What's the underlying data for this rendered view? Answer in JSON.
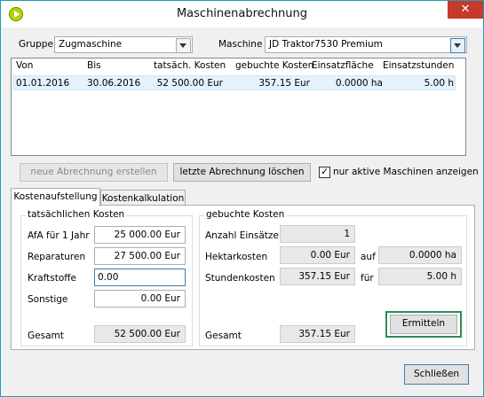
{
  "window": {
    "title": "Maschinenabrechnung",
    "close_glyph": "✕"
  },
  "filter": {
    "gruppe_label": "Gruppe",
    "gruppe_value": "Zugmaschine",
    "maschine_label": "Maschine",
    "maschine_value": "JD Traktor7530 Premium"
  },
  "table": {
    "columns": [
      "Von",
      "Bis",
      "tatsäch. Kosten",
      "gebuchte Kosten",
      "Einsatzfläche",
      "Einsatzstunden"
    ],
    "rows": [
      [
        "01.01.2016",
        "30.06.2016",
        "52 500.00 Eur",
        "357.15 Eur",
        "0.0000 ha",
        "5.00 h"
      ]
    ]
  },
  "actions": {
    "new_label": "neue Abrechnung erstellen",
    "delete_label": "letzte Abrechnung löschen",
    "active_only_label": "nur aktive Maschinen anzeigen",
    "active_only_checked": true
  },
  "tabs": [
    "Kostenaufstellung",
    "Kostenkalkulation"
  ],
  "actual": {
    "title": "tatsächlichen Kosten",
    "afa_label": "AfA für 1 Jahr",
    "afa_value": "25 000.00 Eur",
    "rep_label": "Reparaturen",
    "rep_value": "27 500.00 Eur",
    "kraft_label": "Kraftstoffe",
    "kraft_value": "0.00",
    "sonst_label": "Sonstige",
    "sonst_value": "0.00 Eur",
    "total_label": "Gesamt",
    "total_value": "52 500.00 Eur"
  },
  "booked": {
    "title": "gebuchte Kosten",
    "count_label": "Anzahl Einsätze",
    "count_value": "1",
    "ha_label": "Hektarkosten",
    "ha_value": "0.00 Eur",
    "auf_label": "auf",
    "auf_value": "0.0000 ha",
    "hour_label": "Stundenkosten",
    "hour_value": "357.15 Eur",
    "fuer_label": "für",
    "fuer_value": "5.00 h",
    "calc_label": "Ermitteln",
    "total_label": "Gesamt",
    "total_value": "357.15 Eur"
  },
  "footer": {
    "close_label": "Schließen"
  }
}
